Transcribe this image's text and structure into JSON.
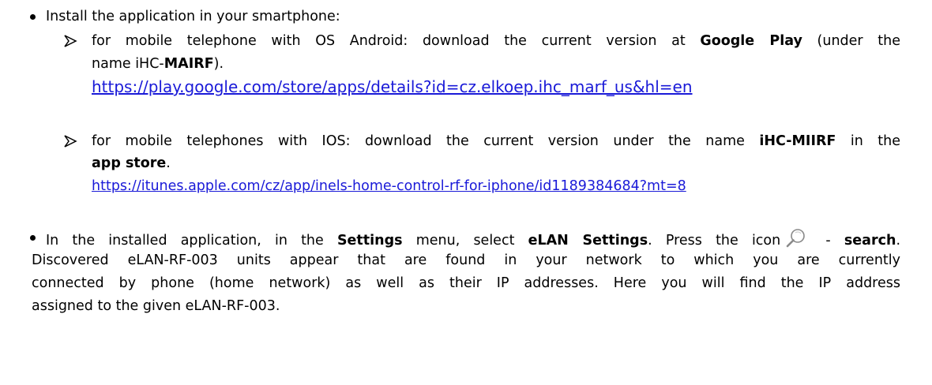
{
  "item1": {
    "intro": "Install the application in your smartphone:",
    "android": {
      "text_before": "for mobile telephone with OS Android: download the current version at ",
      "store_name": "Google Play",
      "text_after": " (under the",
      "line2_prefix": "name iHC-",
      "app_name": "MAIRF",
      "line2_suffix": ").",
      "url": "https://play.google.com/store/apps/details?id=cz.elkoep.ihc_marf_us&hl=en"
    },
    "ios": {
      "text_before": "for mobile telephones with IOS: download the current version under the name ",
      "app_name": "iHC-MIIRF",
      "text_after": " in the",
      "store_name": "app store",
      "store_suffix": ".",
      "url": "https://itunes.apple.com/cz/app/inels-home-control-rf-for-iphone/id1189384684?mt=8"
    }
  },
  "item2": {
    "t1": "In the installed application, in the ",
    "settings": "Settings",
    "t2": " menu, select ",
    "elan_settings": "eLAN Settings",
    "t3": ". Press the icon",
    "t4": " - ",
    "search": "search",
    "t5": ".",
    "line2": "Discovered eLAN-RF-003 units appear that are found in your network to which you are currently",
    "line3": "connected by phone (home network) as well as their IP addresses. Here you will find the IP address",
    "line4": "assigned to the given eLAN-RF-003.",
    "icon": "search-icon"
  }
}
